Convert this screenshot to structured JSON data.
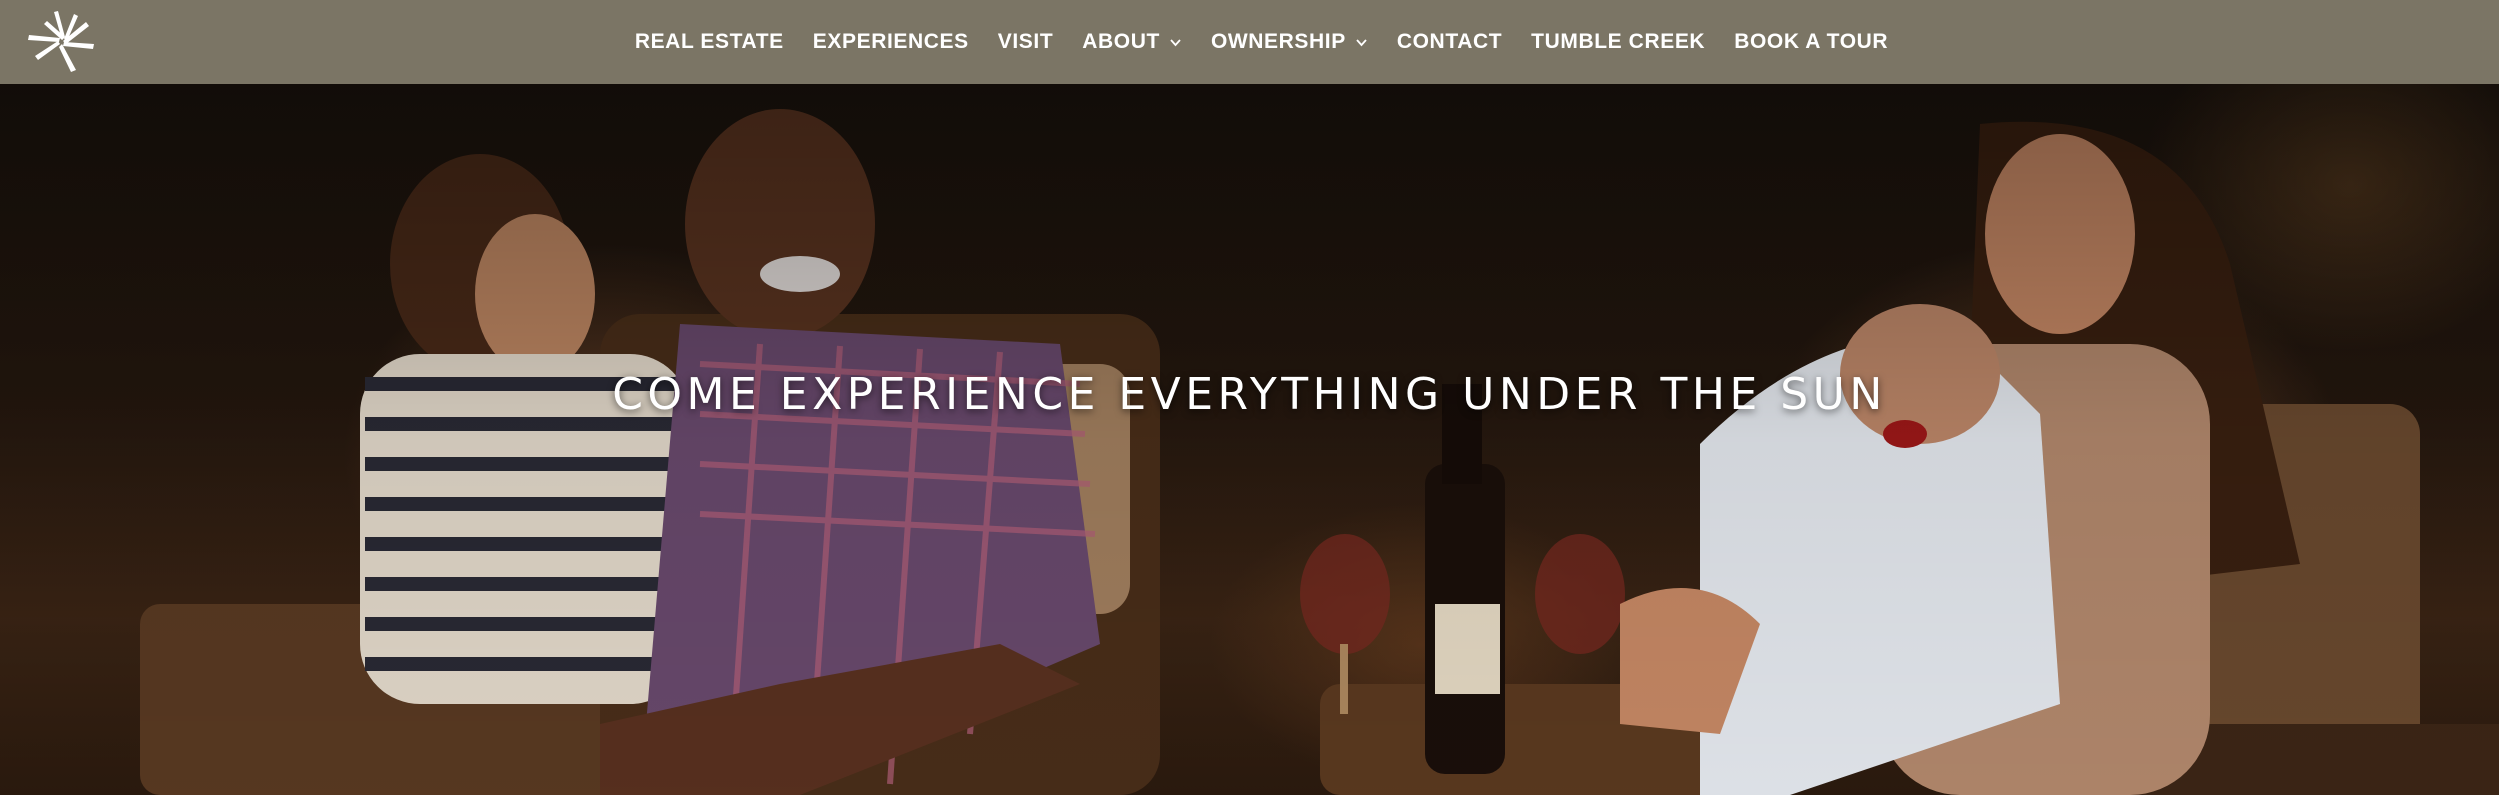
{
  "header": {
    "logo_icon": "sun-burst-logo-icon",
    "nav": [
      {
        "label": "REAL ESTATE",
        "has_dropdown": false
      },
      {
        "label": "EXPERIENCES",
        "has_dropdown": false
      },
      {
        "label": "VISIT",
        "has_dropdown": false
      },
      {
        "label": "ABOUT",
        "has_dropdown": true
      },
      {
        "label": "OWNERSHIP",
        "has_dropdown": true
      },
      {
        "label": "CONTACT",
        "has_dropdown": false
      },
      {
        "label": "TUMBLE CREEK",
        "has_dropdown": false
      },
      {
        "label": "BOOK A TOUR",
        "has_dropdown": false
      }
    ],
    "background_color": "#7b7565"
  },
  "hero": {
    "title": "COME EXPERIENCE EVERYTHING UNDER THE SUN",
    "image_subject": "family-at-evening-fire-photo"
  }
}
